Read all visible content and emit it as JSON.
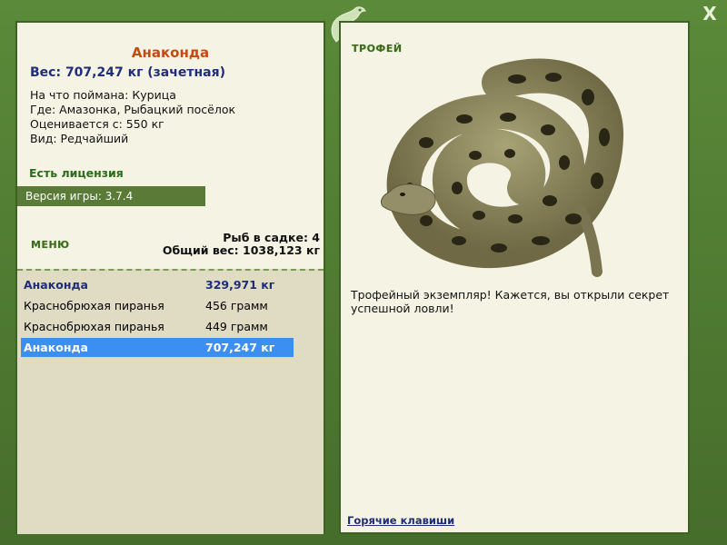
{
  "window": {
    "close_label": "X"
  },
  "fish": {
    "name": "Анаконда",
    "weight_line": "Вес: 707,247 кг (зачетная)",
    "caught_on": "На что поймана: Курица",
    "location": "Где: Амазонка, Рыбацкий посёлок",
    "valued_from": "Оценивается с: 550 кг",
    "kind": "Вид: Редчайший"
  },
  "license_label": "Есть лицензия",
  "version_label": "Версия игры: 3.7.4",
  "menu_label": "МЕНЮ",
  "keepnet": {
    "count_label": "Рыб в садке: 4",
    "total_label": "Общий вес: 1038,123 кг"
  },
  "catches": [
    {
      "name": "Анаконда",
      "weight": "329,971 кг"
    },
    {
      "name": "Краснобрюхая пиранья",
      "weight": "456 грамм"
    },
    {
      "name": "Краснобрюхая пиранья",
      "weight": "449 грамм"
    },
    {
      "name": "Анаконда",
      "weight": "707,247 кг"
    }
  ],
  "trophy": {
    "label": "ТРОФЕЙ",
    "message": "Трофейный экземпляр! Кажется, вы открыли секрет успешной ловли!",
    "hotkeys_label": "Горячие клавиши"
  }
}
